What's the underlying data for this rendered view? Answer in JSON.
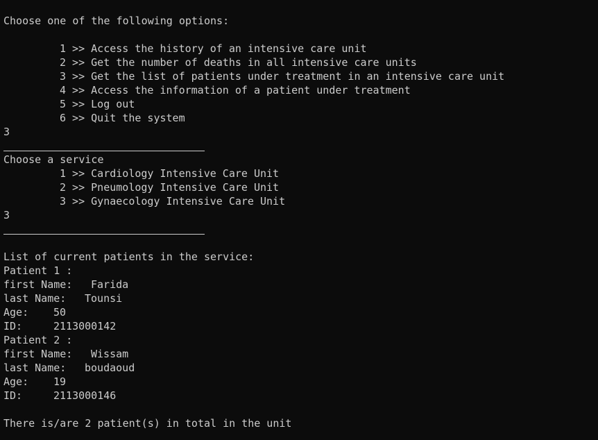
{
  "prompt": "Choose one of the following options:",
  "main_menu": [
    "1 >> Access the history of an intensive care unit",
    "2 >> Get the number of deaths in all intensive care units",
    "3 >> Get the list of patients under treatment in an intensive care unit",
    "4 >> Access the information of a patient under treatment",
    "5 >> Log out",
    "6 >> Quit the system"
  ],
  "input1": "3",
  "service_prompt": "Choose a service",
  "services": [
    "1 >> Cardiology Intensive Care Unit",
    "2 >> Pneumology Intensive Care Unit",
    "3 >> Gynaecology Intensive Care Unit"
  ],
  "input2": "3",
  "list_header": "List of current patients in the service:",
  "patients": [
    {
      "header": "Patient 1 :",
      "first_label": "first Name:",
      "first": "Farida",
      "last_label": "last Name:",
      "last": "Tounsi",
      "age_label": "Age:",
      "age": "50",
      "id_label": "ID:",
      "id": "2113000142"
    },
    {
      "header": "Patient 2 :",
      "first_label": "first Name:",
      "first": "Wissam",
      "last_label": "last Name:",
      "last": "boudaoud",
      "age_label": "Age:",
      "age": "19",
      "id_label": "ID:",
      "id": "2113000146"
    }
  ],
  "total": "There is/are 2 patient(s) in total in the unit",
  "colors": {
    "background": "#0c0c0c",
    "text": "#cccccc"
  }
}
